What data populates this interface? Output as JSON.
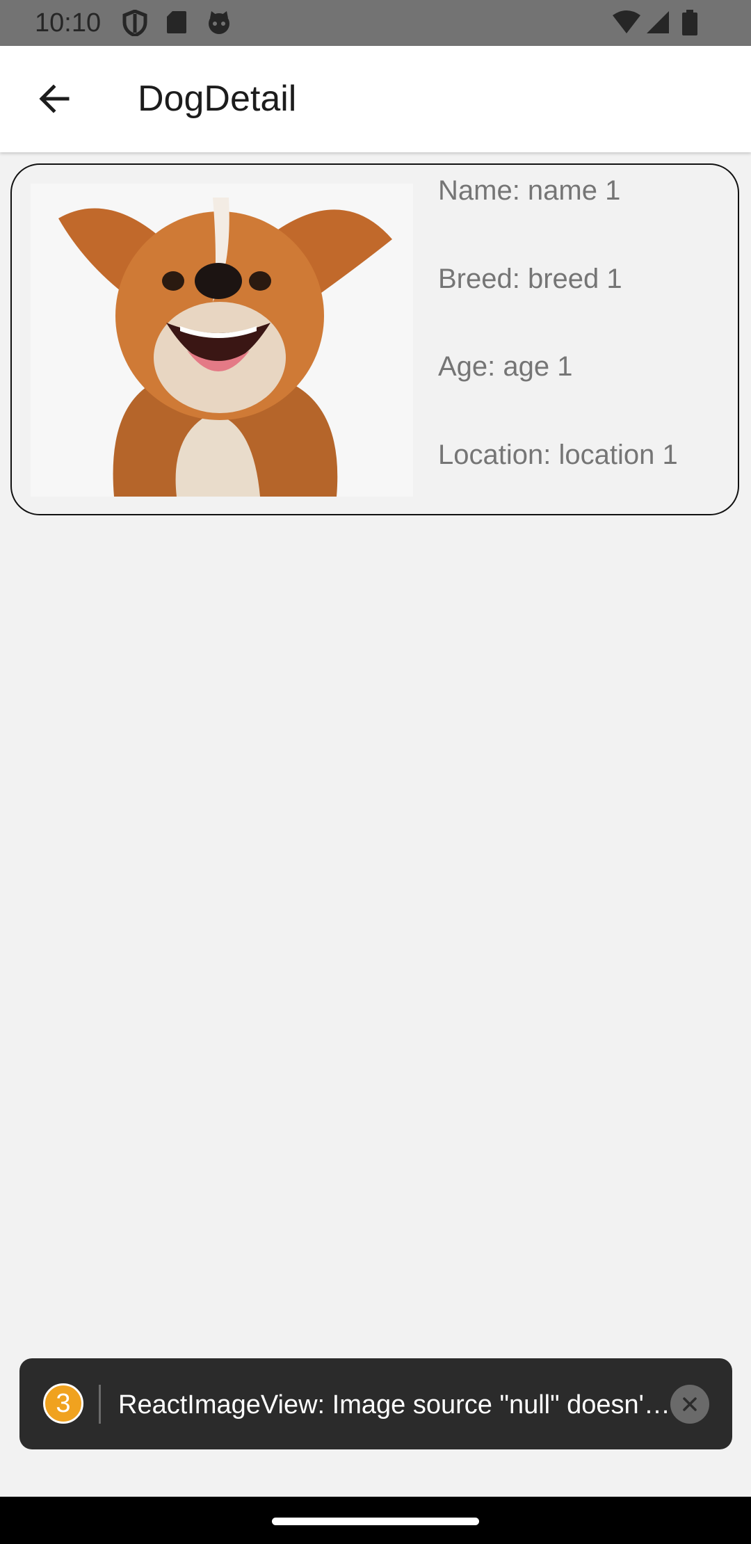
{
  "status_bar": {
    "time": "10:10",
    "left_icons": [
      "shield-icon",
      "sd-card-icon",
      "cat-icon"
    ],
    "right_icons": [
      "wifi-icon",
      "signal-icon",
      "battery-icon"
    ]
  },
  "app_bar": {
    "title": "DogDetail",
    "back_icon": "arrow-back-icon"
  },
  "dog": {
    "name": "Name: name 1",
    "breed": "Breed: breed 1",
    "age": "Age: age 1",
    "location": "Location: location 1"
  },
  "toast": {
    "count": "3",
    "message": "ReactImageView: Image source \"null\" doesn't exist",
    "close_icon": "close-icon"
  },
  "colors": {
    "status_bar": "#737373",
    "background": "#f2f2f2",
    "toast_background": "#2b2b2b",
    "badge": "#f0a21f"
  }
}
